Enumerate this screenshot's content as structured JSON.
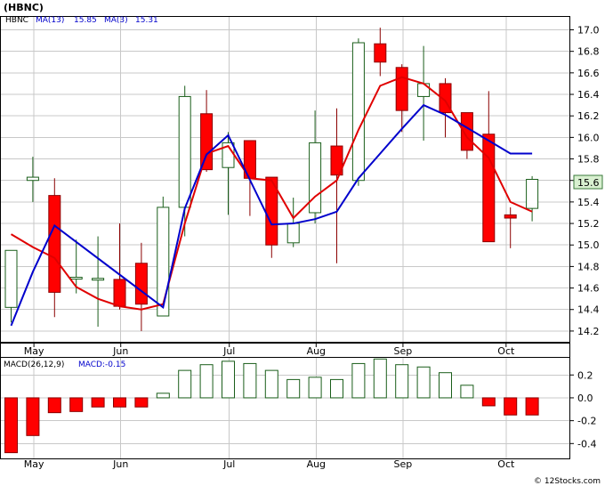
{
  "chart_data": {
    "type": "candlestick",
    "title": "(HBNC)",
    "legend": {
      "symbol": "HBNC",
      "ma13_label": "MA(13)",
      "ma13_value": "15.85",
      "ma3_label": "MA(3)",
      "ma3_value": "15.31"
    },
    "last_price_label": "15.6",
    "x_labels": [
      "May",
      "Jun",
      "Jul",
      "Aug",
      "Sep",
      "Oct"
    ],
    "price_axis": {
      "min": 14.2,
      "max": 17.0,
      "ticks": [
        "14.2",
        "14.4",
        "14.6",
        "14.8",
        "15.0",
        "15.2",
        "15.4",
        "15.6",
        "15.8",
        "16.0",
        "16.2",
        "16.4",
        "16.6",
        "16.8",
        "17.0"
      ]
    },
    "candles": [
      {
        "open": 14.42,
        "close": 14.95,
        "high": 14.95,
        "low": 14.28
      },
      {
        "open": 15.6,
        "close": 15.63,
        "high": 15.82,
        "low": 15.4
      },
      {
        "open": 15.46,
        "close": 14.56,
        "high": 15.62,
        "low": 14.33
      },
      {
        "open": 14.7,
        "close": 14.7,
        "high": 15.05,
        "low": 14.55
      },
      {
        "open": 14.69,
        "close": 14.69,
        "high": 15.08,
        "low": 14.24
      },
      {
        "open": 14.68,
        "close": 14.43,
        "high": 15.2,
        "low": 14.4
      },
      {
        "open": 14.83,
        "close": 14.45,
        "high": 15.02,
        "low": 14.2
      },
      {
        "open": 14.34,
        "close": 15.35,
        "high": 15.45,
        "low": 14.34
      },
      {
        "open": 15.35,
        "close": 16.38,
        "high": 16.48,
        "low": 15.08
      },
      {
        "open": 16.22,
        "close": 15.7,
        "high": 16.44,
        "low": 15.68
      },
      {
        "open": 15.72,
        "close": 15.95,
        "high": 16.05,
        "low": 15.28
      },
      {
        "open": 15.97,
        "close": 15.62,
        "high": 15.97,
        "low": 15.27
      },
      {
        "open": 15.63,
        "close": 15.0,
        "high": 15.63,
        "low": 14.88
      },
      {
        "open": 15.02,
        "close": 15.2,
        "high": 15.44,
        "low": 14.98
      },
      {
        "open": 15.3,
        "close": 15.95,
        "high": 16.25,
        "low": 15.2
      },
      {
        "open": 15.92,
        "close": 15.65,
        "high": 16.27,
        "low": 14.83
      },
      {
        "open": 15.6,
        "close": 16.88,
        "high": 16.92,
        "low": 15.55
      },
      {
        "open": 16.87,
        "close": 16.7,
        "high": 17.02,
        "low": 16.57
      },
      {
        "open": 16.65,
        "close": 16.25,
        "high": 16.68,
        "low": 16.05
      },
      {
        "open": 16.38,
        "close": 16.5,
        "high": 16.85,
        "low": 15.97
      },
      {
        "open": 16.5,
        "close": 16.23,
        "high": 16.55,
        "low": 16.0
      },
      {
        "open": 16.23,
        "close": 15.88,
        "high": 16.23,
        "low": 15.8
      },
      {
        "open": 16.03,
        "close": 15.03,
        "high": 16.43,
        "low": 15.03
      },
      {
        "open": 15.28,
        "close": 15.25,
        "high": 15.35,
        "low": 14.97
      },
      {
        "open": 15.34,
        "close": 15.61,
        "high": 15.64,
        "low": 15.22
      }
    ],
    "ma13": [
      14.25,
      14.75,
      15.18,
      null,
      null,
      null,
      null,
      14.42,
      15.34,
      15.84,
      16.02,
      null,
      15.19,
      15.2,
      15.24,
      15.31,
      15.62,
      15.85,
      16.08,
      16.3,
      16.21,
      null,
      null,
      15.85,
      15.85
    ],
    "ma13_points_idx": [
      0,
      1,
      2,
      7,
      8,
      9,
      10,
      12,
      13,
      14,
      15,
      16,
      17,
      18,
      19,
      20,
      23,
      24
    ],
    "ma3": [
      15.1,
      14.98,
      14.88,
      14.61,
      14.5,
      14.43,
      14.4,
      14.45,
      15.2,
      15.85,
      15.92,
      15.62,
      15.6,
      15.25,
      15.45,
      15.6,
      16.07,
      16.48,
      16.56,
      16.5,
      16.34,
      16.0,
      15.81,
      15.4,
      15.31
    ],
    "macd_label": "MACD(26,12,9)",
    "macd_value_label": "MACD:-0.15",
    "macd_axis": {
      "min": -0.45,
      "max": 0.3,
      "ticks": [
        "0.2",
        "0.0",
        "-0.2",
        "-0.4"
      ]
    },
    "macd_hist": [
      -0.48,
      -0.33,
      -0.13,
      -0.12,
      -0.08,
      -0.08,
      -0.08,
      0.04,
      0.24,
      0.29,
      0.32,
      0.3,
      0.24,
      0.16,
      0.18,
      0.16,
      0.3,
      0.34,
      0.29,
      0.27,
      0.22,
      0.11,
      -0.07,
      -0.15,
      -0.15
    ],
    "colors": {
      "up": "#1a5e1a",
      "down": "#ff0000",
      "ma13": "#0000cc",
      "ma3": "#e00000",
      "macd_pos": "#1a5e1a",
      "macd_neg": "#ff0000"
    }
  },
  "watermark": "© 12Stocks.com"
}
